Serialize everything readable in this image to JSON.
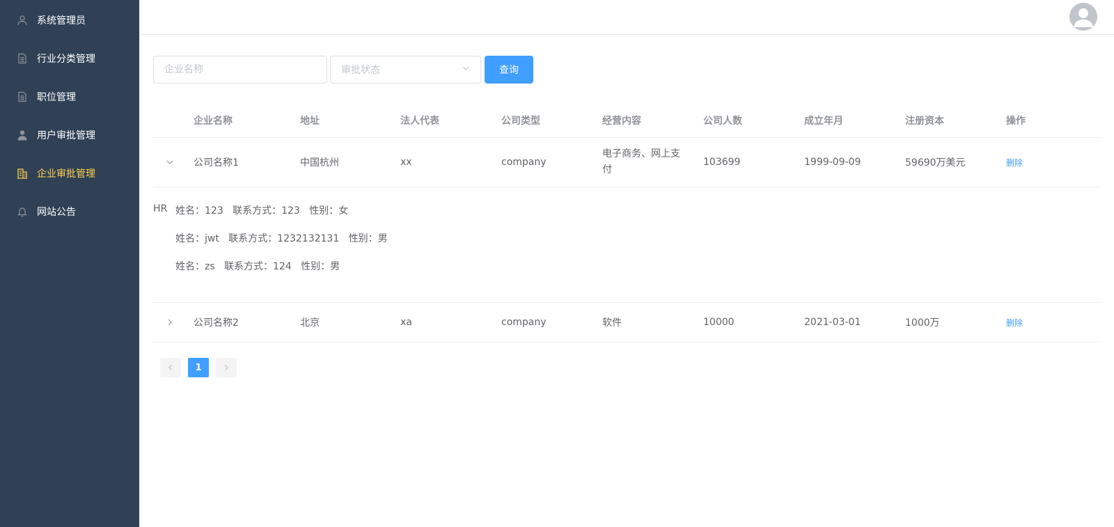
{
  "sidebar": {
    "items": [
      {
        "label": "系统管理员",
        "icon": "user-outline-icon",
        "active": false
      },
      {
        "label": "行业分类管理",
        "icon": "document-icon",
        "active": false
      },
      {
        "label": "职位管理",
        "icon": "document-icon",
        "active": false
      },
      {
        "label": "用户审批管理",
        "icon": "user-solid-icon",
        "active": false
      },
      {
        "label": "企业审批管理",
        "icon": "office-building-icon",
        "active": true
      },
      {
        "label": "网站公告",
        "icon": "bell-icon",
        "active": false
      }
    ],
    "colors": {
      "background": "#304156",
      "text": "#ffffff",
      "active": "#ffd04b"
    }
  },
  "header": {
    "avatar_icon": "avatar-icon"
  },
  "search": {
    "company_placeholder": "企业名称",
    "status_placeholder": "审批状态",
    "query_label": "查询"
  },
  "table": {
    "columns": [
      "企业名称",
      "地址",
      "法人代表",
      "公司类型",
      "经营内容",
      "公司人数",
      "成立年月",
      "注册资本",
      "操作"
    ],
    "rows": [
      {
        "name": "公司名称1",
        "address": "中国杭州",
        "legal_rep": "xx",
        "type": "company",
        "business_line1": "电子商务、网上支",
        "business_line2": "付",
        "employees": "103699",
        "founded": "1999-09-09",
        "capital": "59690万美元",
        "action": "删除",
        "expanded": true
      },
      {
        "name": "公司名称2",
        "address": "北京",
        "legal_rep": "xa",
        "type": "company",
        "business_line1": "软件",
        "business_line2": "",
        "employees": "10000",
        "founded": "2021-03-01",
        "capital": "1000万",
        "action": "删除",
        "expanded": false
      }
    ]
  },
  "expanded_detail": {
    "label": "HR",
    "lines": [
      "姓名：123   联系方式：123   性别：女",
      "姓名：jwt   联系方式：1232132131   性别：男",
      "姓名：zs   联系方式：124   性别：男"
    ]
  },
  "pagination": {
    "current_page": "1"
  },
  "colors": {
    "primary": "#409eff",
    "border": "#ebeef5",
    "header_text": "#909399",
    "text": "#606266"
  }
}
